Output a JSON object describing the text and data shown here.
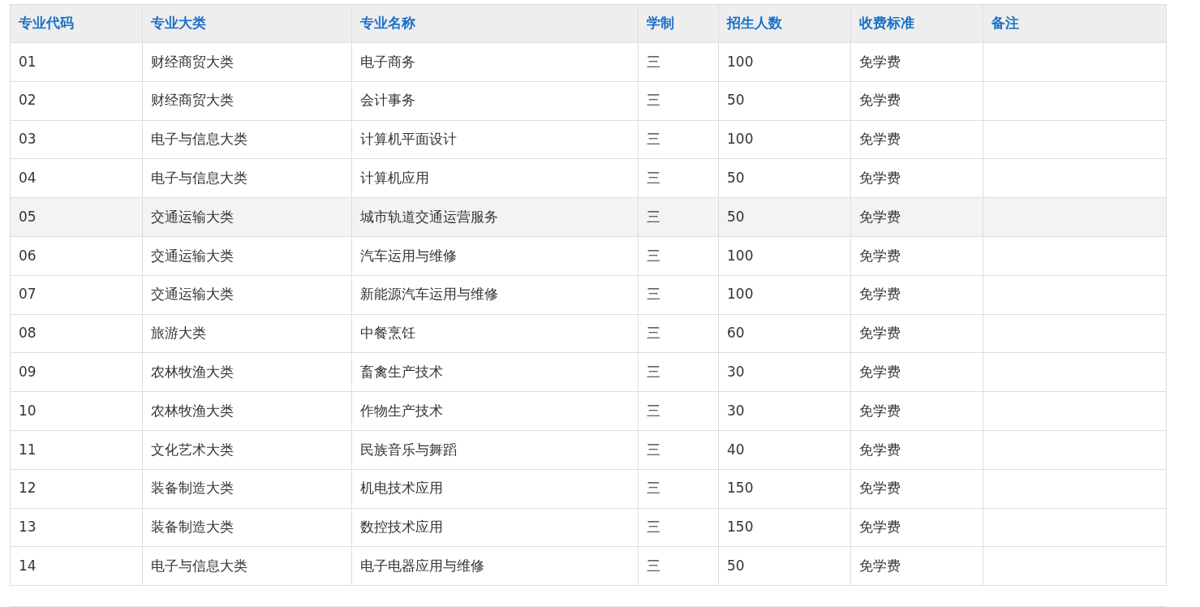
{
  "table": {
    "columns": [
      "专业代码",
      "专业大类",
      "专业名称",
      "学制",
      "招生人数",
      "收费标准",
      "备注"
    ],
    "rows": [
      {
        "cells": [
          "01",
          "财经商贸大类",
          "电子商务",
          "三",
          "100",
          "免学费",
          ""
        ],
        "highlighted": false
      },
      {
        "cells": [
          "02",
          "财经商贸大类",
          "会计事务",
          "三",
          "50",
          "免学费",
          ""
        ],
        "highlighted": false
      },
      {
        "cells": [
          "03",
          "电子与信息大类",
          "计算机平面设计",
          "三",
          "100",
          "免学费",
          ""
        ],
        "highlighted": false
      },
      {
        "cells": [
          "04",
          "电子与信息大类",
          "计算机应用",
          "三",
          "50",
          "免学费",
          ""
        ],
        "highlighted": false
      },
      {
        "cells": [
          "05",
          "交通运输大类",
          "城市轨道交通运营服务",
          "三",
          "50",
          "免学费",
          ""
        ],
        "highlighted": true
      },
      {
        "cells": [
          "06",
          "交通运输大类",
          "汽车运用与维修",
          "三",
          "100",
          "免学费",
          ""
        ],
        "highlighted": false
      },
      {
        "cells": [
          "07",
          "交通运输大类",
          "新能源汽车运用与维修",
          "三",
          "100",
          "免学费",
          ""
        ],
        "highlighted": false
      },
      {
        "cells": [
          "08",
          "旅游大类",
          "中餐烹饪",
          "三",
          "60",
          "免学费",
          ""
        ],
        "highlighted": false
      },
      {
        "cells": [
          "09",
          "农林牧渔大类",
          "畜禽生产技术",
          "三",
          "30",
          "免学费",
          ""
        ],
        "highlighted": false
      },
      {
        "cells": [
          "10",
          "农林牧渔大类",
          "作物生产技术",
          "三",
          "30",
          "免学费",
          ""
        ],
        "highlighted": false
      },
      {
        "cells": [
          "11",
          "文化艺术大类",
          "民族音乐与舞蹈",
          "三",
          "40",
          "免学费",
          ""
        ],
        "highlighted": false
      },
      {
        "cells": [
          "12",
          "装备制造大类",
          "机电技术应用",
          "三",
          "150",
          "免学费",
          ""
        ],
        "highlighted": false
      },
      {
        "cells": [
          "13",
          "装备制造大类",
          "数控技术应用",
          "三",
          "150",
          "免学费",
          ""
        ],
        "highlighted": false
      },
      {
        "cells": [
          "14",
          "电子与信息大类",
          "电子电器应用与维修",
          "三",
          "50",
          "免学费",
          ""
        ],
        "highlighted": false
      }
    ]
  }
}
